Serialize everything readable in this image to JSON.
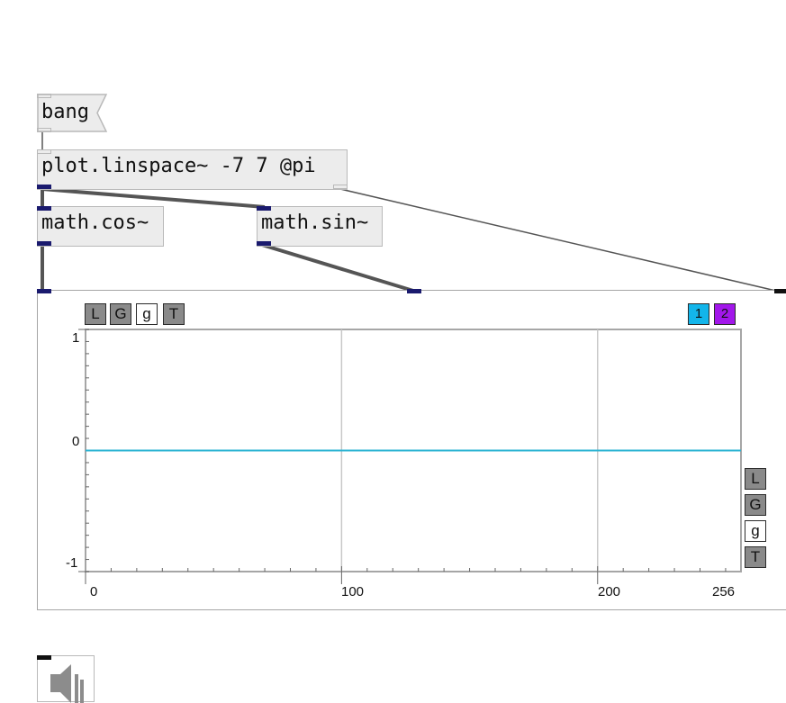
{
  "objects": {
    "bang": "bang",
    "linspace": "plot.linspace~ -7 7 @pi",
    "cos": "math.cos~",
    "sin": "math.sin~"
  },
  "plot": {
    "top_buttons": [
      "L",
      "G",
      "g",
      "T"
    ],
    "side_buttons": [
      "L",
      "G",
      "g",
      "T"
    ],
    "channels": [
      {
        "label": "1",
        "color": "#13b5ea"
      },
      {
        "label": "2",
        "color": "#a217ea"
      }
    ],
    "y_ticks": {
      "top": "1",
      "mid": "0",
      "bottom": "-1"
    },
    "x_ticks": {
      "t0": "0",
      "t100": "100",
      "t200": "200",
      "t256": "256"
    },
    "colors": {
      "series1": "#2bb3d3",
      "grid": "#c8c8c8",
      "frame": "#a6a6a6"
    }
  },
  "chart_data": {
    "type": "line",
    "x": [
      0,
      256
    ],
    "series": [
      {
        "values": [
          0,
          0
        ]
      }
    ],
    "xlim": [
      0,
      256
    ],
    "ylim": [
      -1,
      1
    ],
    "grid": true
  }
}
